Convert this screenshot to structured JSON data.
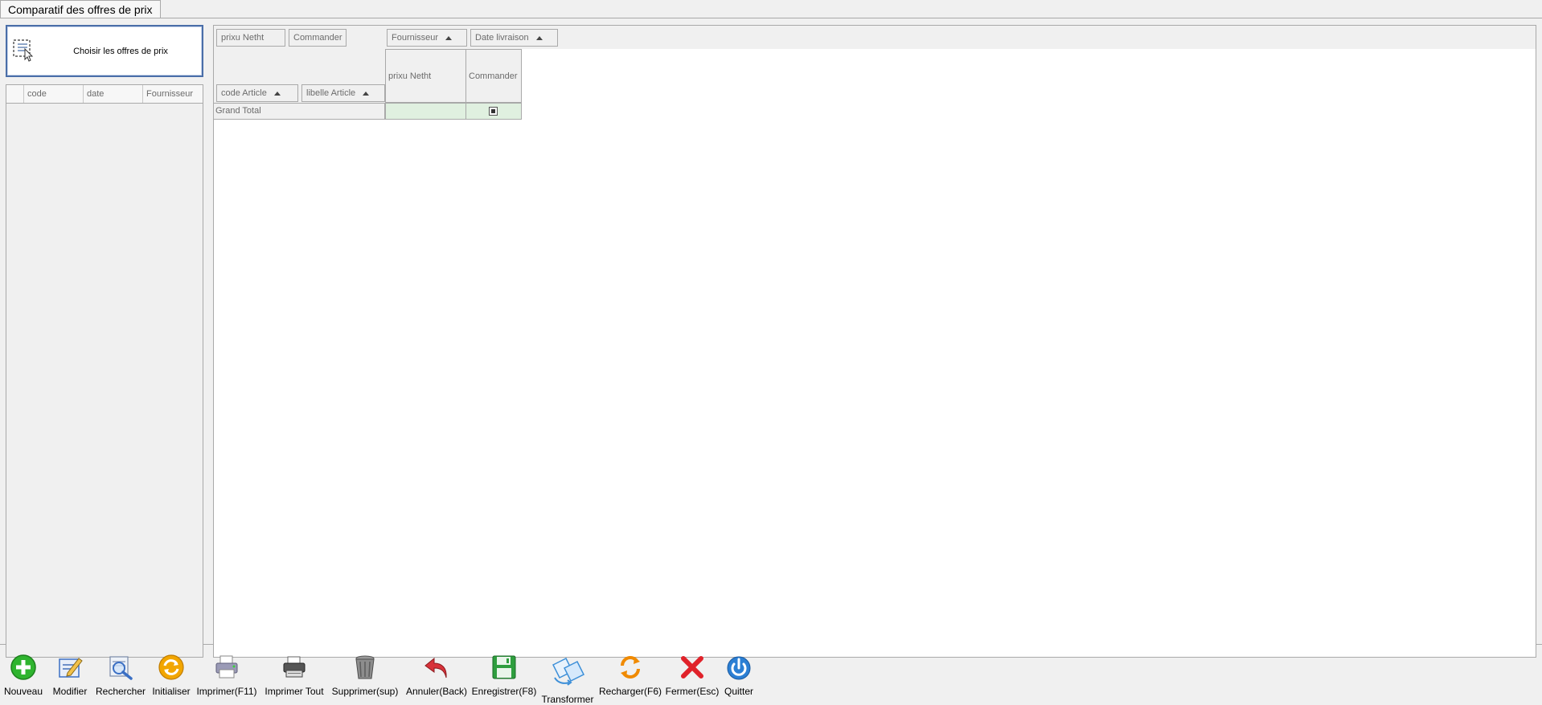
{
  "window": {
    "tab_title": "Comparatif des offres de prix"
  },
  "left_panel": {
    "choose_button_label": "Choisir les offres de prix",
    "grid_columns": [
      "",
      "code",
      "date",
      "Fournisseur"
    ]
  },
  "pivot": {
    "data_fields": [
      "prixu Netht",
      "Commander"
    ],
    "column_fields": [
      "Fournisseur",
      "Date livraison"
    ],
    "row_fields": [
      "code Article",
      "libelle Article"
    ],
    "data_headers": [
      "prixu Netht",
      "Commander"
    ],
    "grand_total_label": "Grand Total",
    "grand_total_commander_checked": true
  },
  "toolbar": {
    "buttons": [
      {
        "label": "Nouveau",
        "icon": "plus-circle-icon",
        "color": "#2fb42f"
      },
      {
        "label": "Modifier",
        "icon": "edit-document-icon",
        "color": "#3a6fc4"
      },
      {
        "label": "Rechercher",
        "icon": "search-document-icon",
        "color": "#3a6fc4"
      },
      {
        "label": "Initialiser",
        "icon": "refresh-ring-icon",
        "color": "#f2a600"
      },
      {
        "label": "Imprimer(F11)",
        "icon": "printer-icon",
        "color": "#7a7a9a"
      },
      {
        "label": "Imprimer Tout",
        "icon": "printer-all-icon",
        "color": "#444444"
      },
      {
        "label": "Supprimer(sup)",
        "icon": "trash-icon",
        "color": "#777777"
      },
      {
        "label": "Annuler(Back)",
        "icon": "undo-arrow-icon",
        "color": "#c4262e"
      },
      {
        "label": "Enregistrer(F8)",
        "icon": "floppy-disk-icon",
        "color": "#2e9e3e"
      },
      {
        "label": "Transformer",
        "icon": "transform-icon",
        "color": "#3d8fd8"
      },
      {
        "label": "Recharger(F6)",
        "icon": "reload-arrows-icon",
        "color": "#f08a00"
      },
      {
        "label": "Fermer(Esc)",
        "icon": "close-x-icon",
        "color": "#e0222a"
      },
      {
        "label": "Quitter",
        "icon": "power-icon",
        "color": "#2b7fd4"
      }
    ]
  }
}
